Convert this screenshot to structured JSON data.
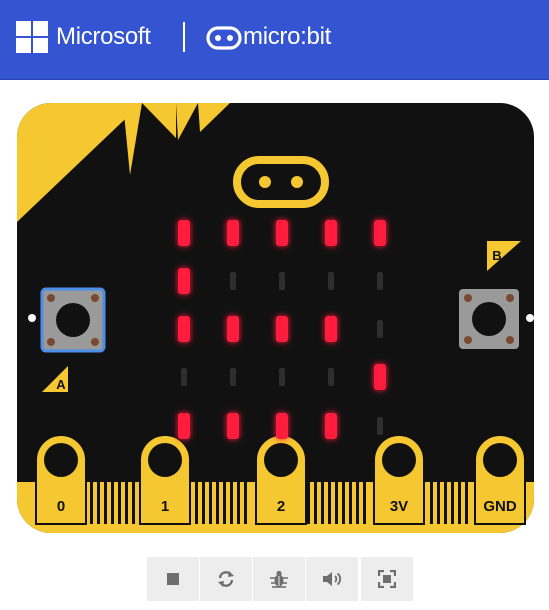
{
  "header": {
    "brand": "Microsoft",
    "product": "micro:bit"
  },
  "board": {
    "buttons": {
      "a_label": "A",
      "b_label": "B"
    },
    "pins": [
      "0",
      "1",
      "2",
      "3V",
      "GND"
    ],
    "led_matrix": [
      [
        1,
        1,
        1,
        1,
        1
      ],
      [
        1,
        0,
        0,
        0,
        0
      ],
      [
        1,
        1,
        1,
        1,
        0
      ],
      [
        0,
        0,
        0,
        0,
        1
      ],
      [
        1,
        1,
        1,
        1,
        0
      ]
    ]
  },
  "toolbar": {
    "items": [
      "stop-icon",
      "restart-icon",
      "debug-icon",
      "mute-icon",
      "fullscreen-icon"
    ]
  },
  "colors": {
    "header_bg": "#3454d1",
    "board_black": "#111111",
    "gold": "#f5c730",
    "led_on": "#ff1a3c"
  }
}
